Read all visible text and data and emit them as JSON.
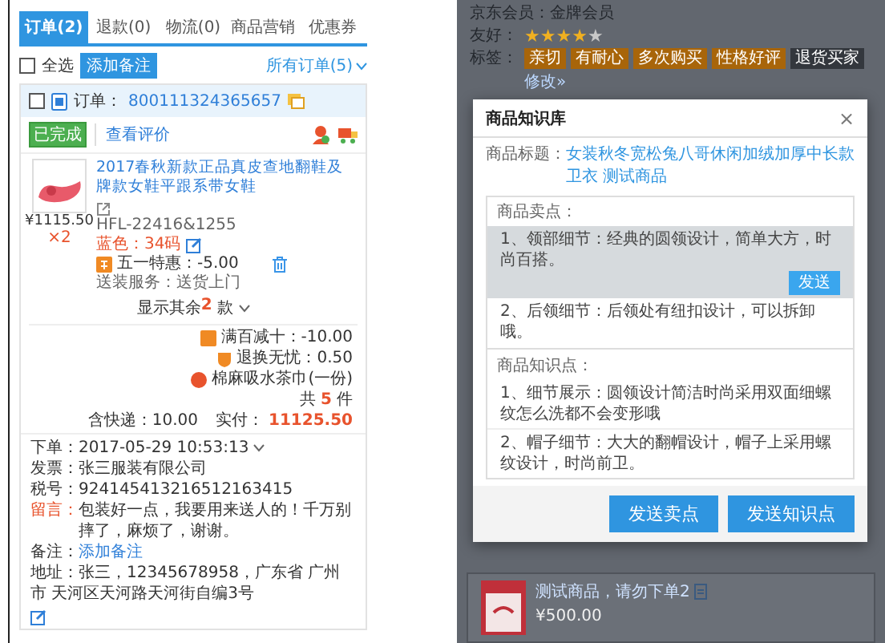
{
  "order_panel": {
    "tabs": [
      {
        "label": "订单(2)",
        "selected": true
      },
      {
        "label": "退款(0)",
        "selected": false
      },
      {
        "label": "物流(0)",
        "selected": false
      },
      {
        "label": "商品营销",
        "selected": false
      },
      {
        "label": "优惠券",
        "selected": false
      }
    ],
    "toolbar": {
      "select_all": {
        "label": "全选",
        "checked": false
      },
      "add_note_button": "添加备注",
      "filter": "所有订单(5)"
    },
    "order": {
      "checked": false,
      "order_label": "订单：",
      "order_number": "800111324365657",
      "status": "已完成",
      "review_link": "查看评价",
      "product": {
        "title": "2017春秋新款正品真皮查地翻鞋及牌款女鞋平跟系带女鞋",
        "sku": "HFL-22416&1255",
        "price": "¥1115.50",
        "quantity": "×2",
        "spec": "蓝色：34码",
        "promotion": "五一特惠：-5.00",
        "service": "送装服务：送货上门"
      },
      "show_more": {
        "prefix": "显示其余",
        "count": "2",
        "suffix": "款"
      },
      "discounts": [
        {
          "text": "满百减十：-10.00",
          "kind": "square",
          "color": "#f08a24"
        },
        {
          "text": "退换无忧：0.50",
          "kind": "shield",
          "color": "#f08a24"
        },
        {
          "text": "棉麻吸水茶巾(一份)",
          "kind": "circle",
          "color": "#e8532d"
        }
      ],
      "total": {
        "prefix": "共",
        "count": "5",
        "suffix": "件"
      },
      "shipping": "含快递：10.00",
      "paid_label": "实付：",
      "paid": "11125.50",
      "details": {
        "placed": "下单：2017-05-29 10:53:13",
        "invoice": "发票：张三服装有限公司",
        "tax": "税号：924145413216512163415",
        "message_label": "留言：",
        "message": "包装好一点，我要用来送人的！千万别摔了，麻烦了，谢谢。",
        "note_label": "备注：",
        "note_link": "添加备注",
        "address": "地址：张三，12345678958，广东省 广州市 天河区天河路天河街自编3号"
      }
    }
  },
  "customer_panel": {
    "membership": "京东会员：金牌会员",
    "rating_label": "友好：",
    "stars": 4,
    "tags_label": "标签：",
    "tags": [
      {
        "text": "亲切",
        "color": "#a8650a"
      },
      {
        "text": "有耐心",
        "color": "#a8650a"
      },
      {
        "text": "多次购买",
        "color": "#a8650a"
      },
      {
        "text": "性格好评",
        "color": "#a8650a"
      },
      {
        "text": "退货买家",
        "color": "#33373d"
      }
    ],
    "edit_link": "修改»",
    "product_card": {
      "title": "测试商品，请勿下单2",
      "price": "¥500.00"
    }
  },
  "knowledge_dialog": {
    "title": "商品知识库",
    "close": "×",
    "product_title_label": "商品标题：",
    "product_title": "女装秋冬宽松兔八哥休闲加绒加厚中长款卫衣 测试商品",
    "selling_points_label": "商品卖点：",
    "selling_points": [
      {
        "text": "1、领部细节：经典的圆领设计，简单大方，时尚百搭。",
        "selected": true
      },
      {
        "text": "2、后领细节：后领处有纽扣设计，可以拆卸哦。",
        "selected": false
      }
    ],
    "send_button": "发送",
    "knowledge_label": "商品知识点：",
    "knowledge_points": [
      {
        "text": "1、细节展示：圆领设计简洁时尚采用双面细螺纹怎么洗都不会变形哦"
      },
      {
        "text": "2、帽子细节：大大的翻帽设计，帽子上采用螺纹设计，时尚前卫。"
      }
    ],
    "buttons": [
      "发送卖点",
      "发送知识点"
    ]
  }
}
